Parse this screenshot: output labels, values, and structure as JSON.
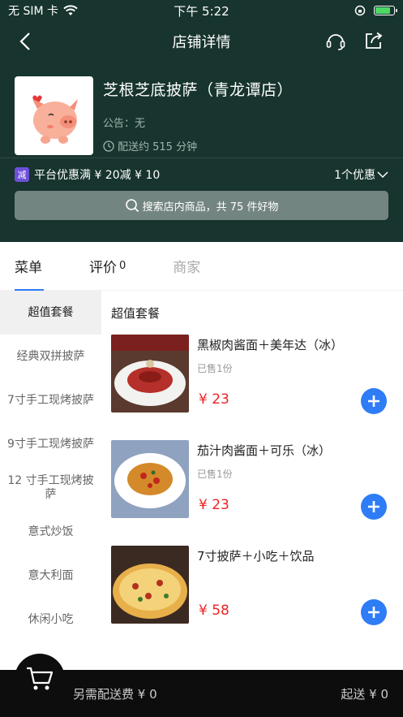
{
  "status": {
    "carrier": "无 SIM 卡",
    "time": "下午 5:22",
    "battery_level": 0.8
  },
  "nav": {
    "title": "店铺详情"
  },
  "store": {
    "name": "芝根芝底披萨（青龙谭店）",
    "notice": "公告：无",
    "delivery": "配送约 515 分钟"
  },
  "promo": {
    "badge": "减",
    "text": "平台优惠满 ¥ 20减 ¥ 10",
    "more": "1个优惠"
  },
  "search": {
    "placeholder": "搜索店内商品，共 75 件好物"
  },
  "tabs": [
    {
      "label": "菜单",
      "count": ""
    },
    {
      "label": "评价",
      "count": "0"
    },
    {
      "label": "商家",
      "count": ""
    }
  ],
  "sidebar": [
    {
      "label": "超值套餐"
    },
    {
      "label": "经典双拼披萨"
    },
    {
      "label": "7寸手工现烤披萨"
    },
    {
      "label": "9寸手工现烤披萨"
    },
    {
      "label": "12 寸手工现烤披萨"
    },
    {
      "label": "意式炒饭"
    },
    {
      "label": "意大利面"
    },
    {
      "label": "休闲小吃"
    }
  ],
  "section": {
    "title": "超值套餐"
  },
  "items": [
    {
      "name": "黑椒肉酱面＋美年达（冰）",
      "sold": "已售1份",
      "price": "¥ 23"
    },
    {
      "name": "茄汁肉酱面＋可乐（冰）",
      "sold": "已售1份",
      "price": "¥ 23"
    },
    {
      "name": "7寸披萨＋小吃＋饮品",
      "sold": "",
      "price": "¥ 58"
    }
  ],
  "cart": {
    "fee": "另需配送费 ¥ 0",
    "min_order": "起送 ¥ 0"
  },
  "colors": {
    "header_bg": "#17342e",
    "accent": "#2e7cf6",
    "price": "#e22222",
    "promo_badge": "#6c4fd8"
  }
}
